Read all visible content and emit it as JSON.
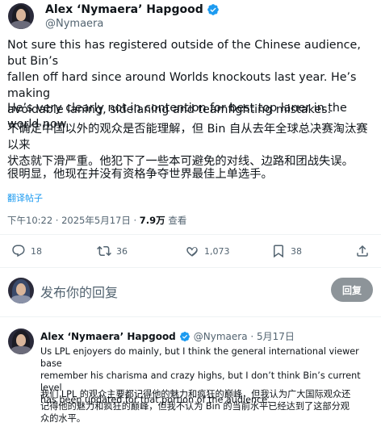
{
  "post": {
    "author_name": "Alex ‘Nymaera’ Hapgood",
    "author_handle": "@Nymaera",
    "text_en_1": "Not sure this has registered outside of the Chinese audience, but Bin’s\nfallen off hard since around Worlds knockouts last year. He’s making\navoidable laning, sidelaning and teamfighting mistakes.",
    "text_en_2": "He’s very clearly not in contention for best top laner in the world now.",
    "text_zh_1": "不确定中国以外的观众是否能理解，但 Bin 自从去年全球总决赛淘汰赛以来\n状态就下滑严重。他犯下了一些本可避免的对线、边路和团战失误。",
    "text_zh_2": "很明显，他现在并没有资格争夺世界最佳上单选手。",
    "translate_label": "翻译帖子",
    "timestamp": "下午10:22 · 2025年5月17日 · ",
    "views_count": "7.9万",
    "views_label": " 查看",
    "replies": "18",
    "retweets": "36",
    "likes": "1,073",
    "bookmarks": "38"
  },
  "composer": {
    "placeholder": "发布你的回复",
    "reply_button": "回复"
  },
  "reply": {
    "author_name": "Alex ‘Nymaera’ Hapgood",
    "author_handle": "@Nymaera · 5月17日",
    "text_en": "Us LPL enjoyers do mainly, but I think the general international viewer base\nremember his charisma and crazy highs, but I don’t think Bin’s current level\nhas been updated for that portion of the audience.",
    "text_zh": "我们 LPL 的观众主要都记得他的魅力和疯狂的巅峰，但我认为广大国际观众还\n记得他的魅力和疯狂的巅峰，但我不认为 Bin 的当前水平已经达到了这部分观\n众的水平。"
  },
  "colors": {
    "accent": "#1d9bf0",
    "muted": "#536471",
    "reply_button_bg": "#8d9499"
  },
  "icons": [
    "verified-badge-icon",
    "reply-icon",
    "retweet-icon",
    "like-icon",
    "views-icon",
    "bookmark-icon",
    "share-icon"
  ]
}
